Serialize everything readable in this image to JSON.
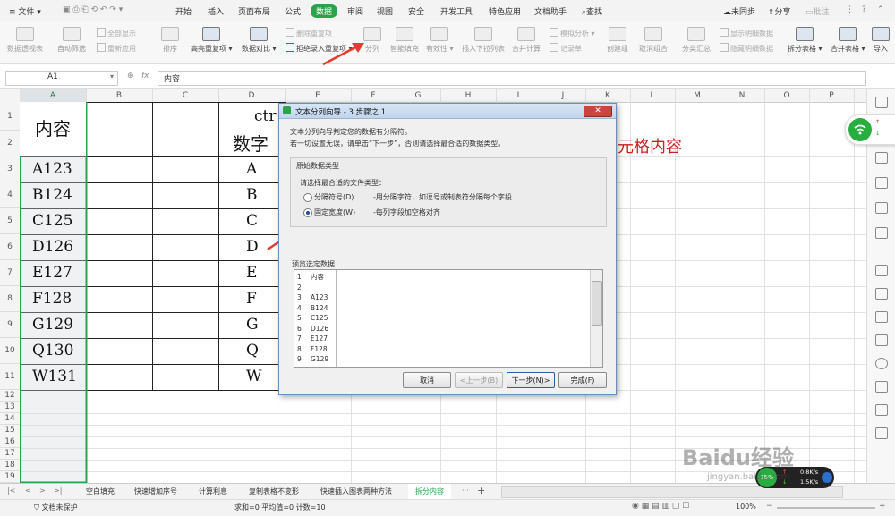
{
  "menubar": {
    "file": "文件",
    "tabs": [
      "开始",
      "插入",
      "页面布局",
      "公式",
      "数据",
      "审阅",
      "视图",
      "安全",
      "开发工具",
      "特色应用",
      "文档助手"
    ],
    "search": "查找",
    "sync": "未同步",
    "share": "分享",
    "comment": "批注"
  },
  "ribbon": {
    "pivot": "数据透视表",
    "autofilter": "自动筛选",
    "show_all": "全部显示",
    "reapply": "重新应用",
    "sort": "排序",
    "highlight_dup": "高亮重复项",
    "compare": "数据对比",
    "delete_dup": "删除重复项",
    "reject_dup": "拒绝录入重复项",
    "split": "分列",
    "smart_fill": "智能填充",
    "validity": "有效性",
    "insert_dropdown": "插入下拉列表",
    "merge_calc": "合并计算",
    "simulate": "模拟分析",
    "record": "记录单",
    "create_group": "创建组",
    "ungroup": "取消组合",
    "subtotal": "分类汇总",
    "show_detail": "显示明细数据",
    "hide_detail": "隐藏明细数据",
    "split_table": "拆分表格",
    "merge_table": "合并表格",
    "import": "导入"
  },
  "formula_bar": {
    "name_box": "A1",
    "fx": "fx",
    "content": "内容"
  },
  "columns": [
    "A",
    "B",
    "C",
    "D",
    "E",
    "F",
    "G",
    "H",
    "I",
    "J",
    "K",
    "L",
    "M",
    "N",
    "O",
    "P"
  ],
  "rows": [
    "1",
    "2",
    "3",
    "4",
    "5",
    "6",
    "7",
    "8",
    "9",
    "10",
    "11",
    "12",
    "13",
    "14",
    "15",
    "16",
    "17",
    "18",
    "19",
    "20"
  ],
  "sheet": {
    "a_header": "内容",
    "a_values": [
      "A123",
      "B124",
      "C125",
      "D126",
      "E127",
      "F128",
      "G129",
      "Q130",
      "W131"
    ],
    "d_header_top": "ctr",
    "d_header": "数字",
    "d_values": [
      "A",
      "B",
      "C",
      "D",
      "E",
      "F",
      "G",
      "Q",
      "W"
    ],
    "red_text": "元格内容"
  },
  "dialog": {
    "title": "文本分列向导 - 3 步骤之 1",
    "intro1": "文本分列向导判定您的数据有分隔符。",
    "intro2": "若一切设置无误，请单击“下一步”，否则请选择最合适的数据类型。",
    "group_label": "原始数据类型",
    "prompt": "请选择最合适的文件类型：",
    "opt1_label": "分隔符号(D)",
    "opt1_desc": "-用分隔字符，如逗号或制表符分隔每个字段",
    "opt2_label": "固定宽度(W)",
    "opt2_desc": "-每列字段加空格对齐",
    "preview_label": "预览选定数据",
    "preview_rows": [
      {
        "n": "1",
        "t": "内容"
      },
      {
        "n": "2",
        "t": ""
      },
      {
        "n": "3",
        "t": "A123"
      },
      {
        "n": "4",
        "t": "B124"
      },
      {
        "n": "5",
        "t": "C125"
      },
      {
        "n": "6",
        "t": "D126"
      },
      {
        "n": "7",
        "t": "E127"
      },
      {
        "n": "8",
        "t": "F128"
      },
      {
        "n": "9",
        "t": "G129"
      }
    ],
    "cancel": "取消",
    "back": "<上一步(B)",
    "next": "下一步(N)>",
    "finish": "完成(F)"
  },
  "sheet_tabs": [
    "空白填充",
    "快速增加序号",
    "计算利息",
    "复制表格不变形",
    "快速插入图表两种方法",
    "拆分内容"
  ],
  "status": {
    "doc": "文档未保护",
    "stats": "求和=0  平均值=0  计数=10",
    "zoom": "100%"
  },
  "net": {
    "percent": "75%",
    "up": "0.8K/s",
    "down": "1.5K/s"
  },
  "watermark": {
    "brand": "Baidu经验",
    "url": "jingyan.baidu.com"
  },
  "colors": {
    "accent": "#2aa34a",
    "red_text": "#cc1f1f",
    "arrow": "#e53b2c"
  }
}
